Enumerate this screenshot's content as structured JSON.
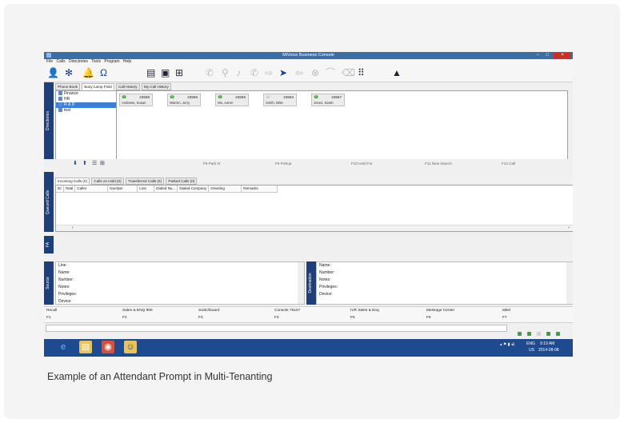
{
  "caption": "Example of an Attendant Prompt in Multi-Tenanting",
  "window": {
    "title": "MiVoice Business Console",
    "close_glyph": "×",
    "min_glyph": "−",
    "max_glyph": "□"
  },
  "menu": [
    "File",
    "Calls",
    "Directories",
    "Tools",
    "Program",
    "Help"
  ],
  "directory_tabs": [
    "Phone Book",
    "Busy Lamp Field",
    "Call History",
    "My Call History"
  ],
  "directory_label": "Directories",
  "tree": [
    {
      "label": "Finance",
      "selected": false
    },
    {
      "label": "HR",
      "selected": false
    },
    {
      "label": "R & D",
      "selected": true
    },
    {
      "label": "test",
      "selected": false
    }
  ],
  "blf_cards": [
    {
      "ext": "23568",
      "name": "Andrews, Susan"
    },
    {
      "ext": "23566",
      "name": "Warren, Jerry"
    },
    {
      "ext": "23565",
      "name": "Wu, Aaron"
    },
    {
      "ext": "23563",
      "name": "Smith, Mike"
    },
    {
      "ext": "23567",
      "name": "Jones, Sarah"
    }
  ],
  "fkeys": [
    "F8 Park At",
    "F9 Pickup",
    "F10 Hold For",
    "F11 New Search",
    "F12 Call"
  ],
  "queued_label": "Queued Calls",
  "queue_tabs": [
    "Incoming Calls (0)",
    "Calls on Hold (0)",
    "Transferred Calls (0)",
    "Parked Calls (0)"
  ],
  "queue_columns": [
    "ID",
    "Total",
    "Caller",
    "Number",
    "Line",
    "Dialed Nu...",
    "Dialed Company",
    "Greeting",
    "Remarks"
  ],
  "fa_label": "FA",
  "source_label": "Source",
  "source_fields": [
    "Line:",
    "Name:",
    "Number:",
    "Notes:",
    "Privileges:",
    "Device:"
  ],
  "destination_label": "Destination",
  "destination_fields": [
    "Name:",
    "Number:",
    "Notes:",
    "Privileges:",
    "Device:"
  ],
  "tenants": [
    "Recall",
    "Sales & ENQ 800",
    "Switchboard",
    "Console 76107",
    "IVR Sales & Enq",
    "Message Center",
    "Mitel"
  ],
  "function_keys": [
    "F1",
    "F2",
    "F3",
    "F4",
    "F5",
    "F6",
    "F7"
  ],
  "tray": {
    "lang": "ENG",
    "region": "US",
    "time": "9:19 AM",
    "date": "2014-08-08"
  }
}
